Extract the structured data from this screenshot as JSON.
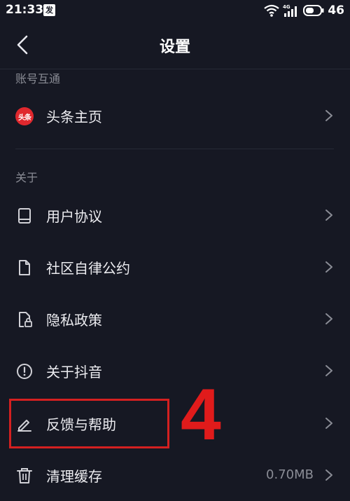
{
  "status_bar": {
    "time": "21:33",
    "ime_label": "发",
    "network": "4G",
    "battery_level": "46"
  },
  "header": {
    "title": "设置"
  },
  "sections": [
    {
      "label": "账号互通",
      "items": [
        {
          "label": "头条主页",
          "icon": "toutiao-logo",
          "logo_text": "头条"
        }
      ]
    },
    {
      "label": "关于",
      "items": [
        {
          "label": "用户协议",
          "icon": "book-icon"
        },
        {
          "label": "社区自律公约",
          "icon": "document-icon"
        },
        {
          "label": "隐私政策",
          "icon": "privacy-lock-icon"
        },
        {
          "label": "关于抖音",
          "icon": "info-icon"
        },
        {
          "label": "反馈与帮助",
          "icon": "edit-icon"
        },
        {
          "label": "清理缓存",
          "icon": "trash-icon",
          "value": "0.70MB"
        }
      ]
    }
  ],
  "annotation": {
    "step_number": "4"
  },
  "colors": {
    "background": "#161823",
    "highlight": "#d42020",
    "text_primary": "#ececf0",
    "text_secondary": "#8a8c95"
  }
}
